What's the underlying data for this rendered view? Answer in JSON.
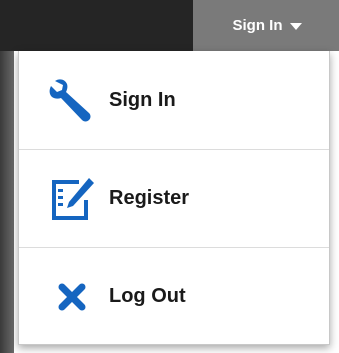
{
  "topbar": {
    "signin_toggle_label": "Sign In"
  },
  "menu": {
    "items": [
      {
        "label": "Sign In",
        "icon": "wrench-icon"
      },
      {
        "label": "Register",
        "icon": "register-form-icon"
      },
      {
        "label": "Log Out",
        "icon": "close-x-icon"
      }
    ]
  },
  "colors": {
    "icon_blue": "#1565c0",
    "topbar_bg": "#252525",
    "toggle_bg": "#7a7a7a"
  }
}
